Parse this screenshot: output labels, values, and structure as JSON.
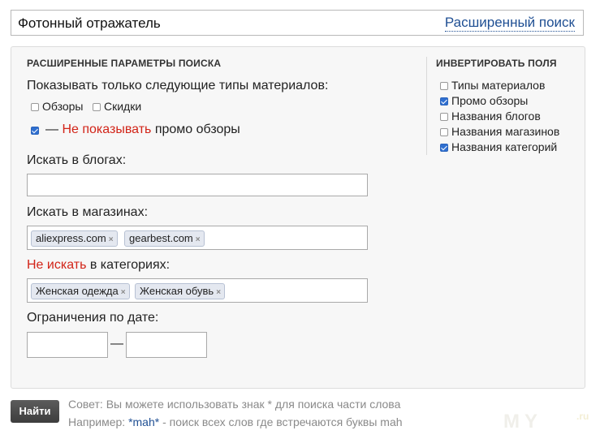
{
  "search": {
    "query": "Фотонный отражатель",
    "advanced_link": "Расширенный поиск"
  },
  "advanced": {
    "title": "РАСШИРЕННЫЕ ПАРАМЕТРЫ ПОИСКА",
    "show_types_label": "Показывать только следующие типы материалов:",
    "types": [
      {
        "label": "Обзоры",
        "checked": false
      },
      {
        "label": "Скидки",
        "checked": false
      }
    ],
    "promo": {
      "checked": true,
      "dash": "—",
      "negation": "Не показывать",
      "rest": "промо обзоры"
    },
    "blogs": {
      "label": "Искать в блогах:",
      "value": ""
    },
    "shops": {
      "label": "Искать в магазинах:",
      "tags": [
        "aliexpress.com",
        "gearbest.com"
      ]
    },
    "categories": {
      "negation": "Не искать",
      "rest": "в категориях:",
      "tags": [
        "Женская одежда",
        "Женская обувь"
      ]
    },
    "date": {
      "label": "Ограничения по дате:",
      "separator": "—",
      "from": "",
      "to": ""
    }
  },
  "invert": {
    "title": "ИНВЕРТИРОВАТЬ ПОЛЯ",
    "items": [
      {
        "label": "Типы материалов",
        "checked": false
      },
      {
        "label": "Промо обзоры",
        "checked": true
      },
      {
        "label": "Названия блогов",
        "checked": false
      },
      {
        "label": "Названия магазинов",
        "checked": false
      },
      {
        "label": "Названия категорий",
        "checked": true
      }
    ]
  },
  "footer": {
    "button": "Найти",
    "tip_line1": "Совет: Вы можете использовать знак * для поиска части слова",
    "tip_line2_prefix": "Например: ",
    "tip_line2_example": "*mah*",
    "tip_line2_suffix": " - поиск всех слов где встречаются буквы mah"
  },
  "watermark": {
    "text": "MY",
    "suffix": ".ru"
  },
  "colors": {
    "link": "#1f4f93",
    "negation": "#d22418",
    "checkbox_checked": "#2f6fd0",
    "button": "#3d3d3d"
  },
  "icons": {
    "tag_remove": "×"
  }
}
